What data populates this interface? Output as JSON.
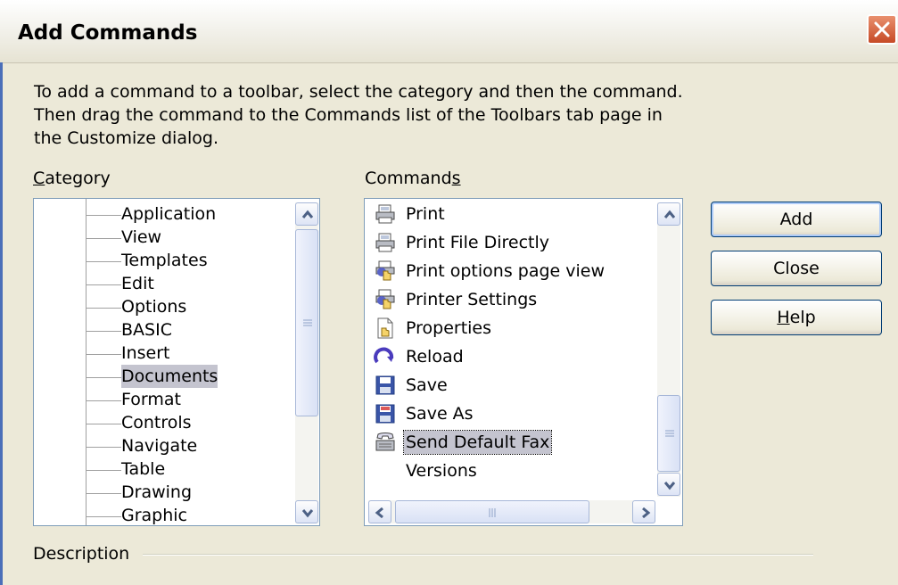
{
  "window": {
    "title": "Add Commands"
  },
  "instructions": "To add a command to a toolbar, select the category and then the command.\nThen drag the command to the Commands list of the Toolbars tab page in\nthe Customize dialog.",
  "category": {
    "label": "Category",
    "items": [
      "Application",
      "View",
      "Templates",
      "Edit",
      "Options",
      "BASIC",
      "Insert",
      "Documents",
      "Format",
      "Controls",
      "Navigate",
      "Table",
      "Drawing",
      "Graphic"
    ],
    "selected": "Documents"
  },
  "commands": {
    "label": "Commands",
    "items": [
      {
        "label": "Print",
        "icon": "printer-icon"
      },
      {
        "label": "Print File Directly",
        "icon": "printer-icon"
      },
      {
        "label": "Print options page view",
        "icon": "printer-hand-icon"
      },
      {
        "label": "Printer Settings",
        "icon": "printer-hand-icon"
      },
      {
        "label": "Properties",
        "icon": "document-hand-icon"
      },
      {
        "label": "Reload",
        "icon": "reload-icon"
      },
      {
        "label": "Save",
        "icon": "floppy-disk-icon"
      },
      {
        "label": "Save As",
        "icon": "floppy-disk-red-icon"
      },
      {
        "label": "Send Default Fax",
        "icon": "fax-icon"
      },
      {
        "label": "Versions",
        "icon": ""
      }
    ],
    "selected": "Send Default Fax"
  },
  "buttons": {
    "add": "Add",
    "close": "Close",
    "help": "Help"
  },
  "description_label": "Description",
  "colors": {
    "selection": "#c4c4cf",
    "dialog_bg": "#ece9d8",
    "close_button": "#c64a26"
  }
}
